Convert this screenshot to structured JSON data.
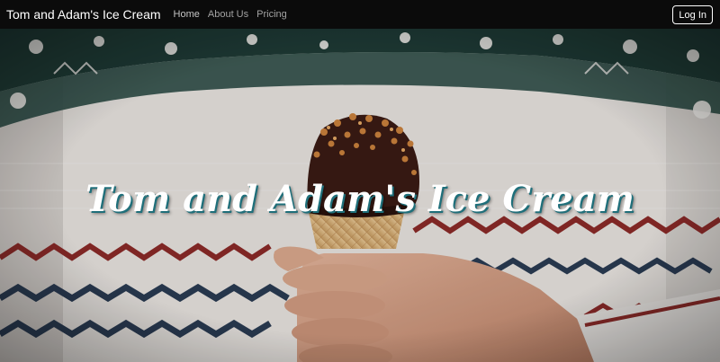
{
  "navbar": {
    "brand": "Tom and Adam's Ice Cream",
    "links": [
      {
        "label": "Home"
      },
      {
        "label": "About Us"
      },
      {
        "label": "Pricing"
      }
    ],
    "login_label": "Log In"
  },
  "hero": {
    "title": "Tom and Adam's Ice Cream",
    "image_subject": "person in a knitted winter sweater holding a chocolate-dipped ice cream cone with nuts",
    "colors": {
      "sweater_base": "#e6e2de",
      "pattern_dark_green": "#1f3b36",
      "pattern_red": "#8a2a28",
      "pattern_navy": "#2a3b52",
      "title_shadow": "#1f6f7a"
    }
  }
}
